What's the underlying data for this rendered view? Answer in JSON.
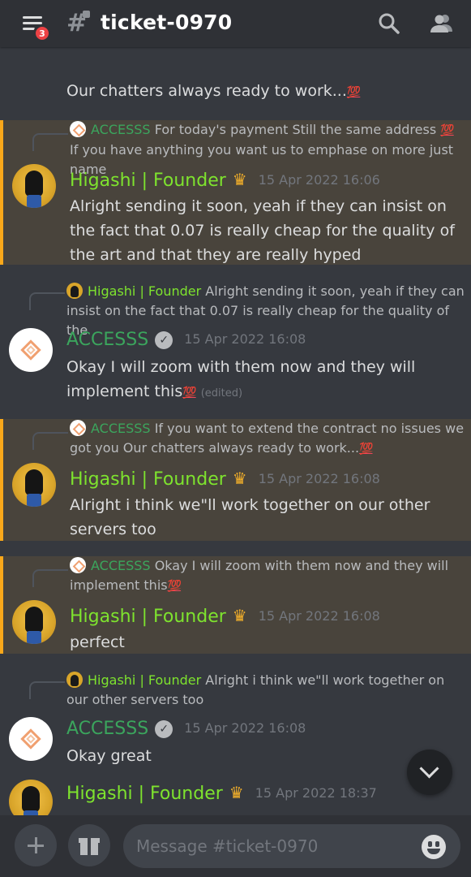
{
  "header": {
    "channel": "ticket-0970",
    "notif_count": "3"
  },
  "system_line": "Our chatters always ready to work...",
  "messages": [
    {
      "reply_author": "ACCESSS",
      "reply_text": "For today's payment  Still the same address",
      "reply_text2": " If you have anything you want us to emphase on more just name",
      "author": "Higashi | Founder",
      "time": "15 Apr 2022 16:06",
      "text": "Alright sending it soon, yeah if they can insist on the fact that 0.07 is really cheap for the quality of the art and that they are really hyped"
    },
    {
      "reply_author": "Higashi | Founder",
      "reply_text": "Alright sending it soon, yeah if they can insist on the fact that 0.07 is really cheap for the quality of the",
      "author": "ACCESSS",
      "time": "15 Apr 2022 16:08",
      "text": "Okay I will zoom with them now and they will implement this",
      "edited": "(edited)"
    },
    {
      "reply_author": "ACCESSS",
      "reply_text": "If you want to extend the contract no issues we got you  Our chatters always ready to work...",
      "author": "Higashi | Founder",
      "time": "15 Apr 2022 16:08",
      "text": "Alright i think we\"ll work together on our other servers too"
    },
    {
      "reply_author": "ACCESSS",
      "reply_text": "Okay I will zoom with them now and they will implement this",
      "author": "Higashi | Founder",
      "time": "15 Apr 2022 16:08",
      "text": "perfect"
    },
    {
      "reply_author": "Higashi | Founder",
      "reply_text": "Alright i think we\"ll work together on our other servers too",
      "author": "ACCESSS",
      "time": "15 Apr 2022 16:08",
      "text": "Okay great"
    },
    {
      "author": "Higashi | Founder",
      "time": "15 Apr 2022 18:37"
    }
  ],
  "composer": {
    "placeholder": "Message #ticket-0970"
  },
  "emoji": {
    "hundred": "💯",
    "crown": "♛",
    "check": "✓"
  },
  "colors": {
    "mention_bg": "#49443c",
    "mention_bar": "#faa81a",
    "founder_name": "#7ee32e",
    "accesss_name": "#3ba55d"
  },
  "icons": [
    "hamburger-menu-icon",
    "hash-channel-icon",
    "search-icon",
    "members-icon",
    "chevron-down-icon",
    "plus-icon",
    "gift-icon",
    "emoji-icon"
  ]
}
